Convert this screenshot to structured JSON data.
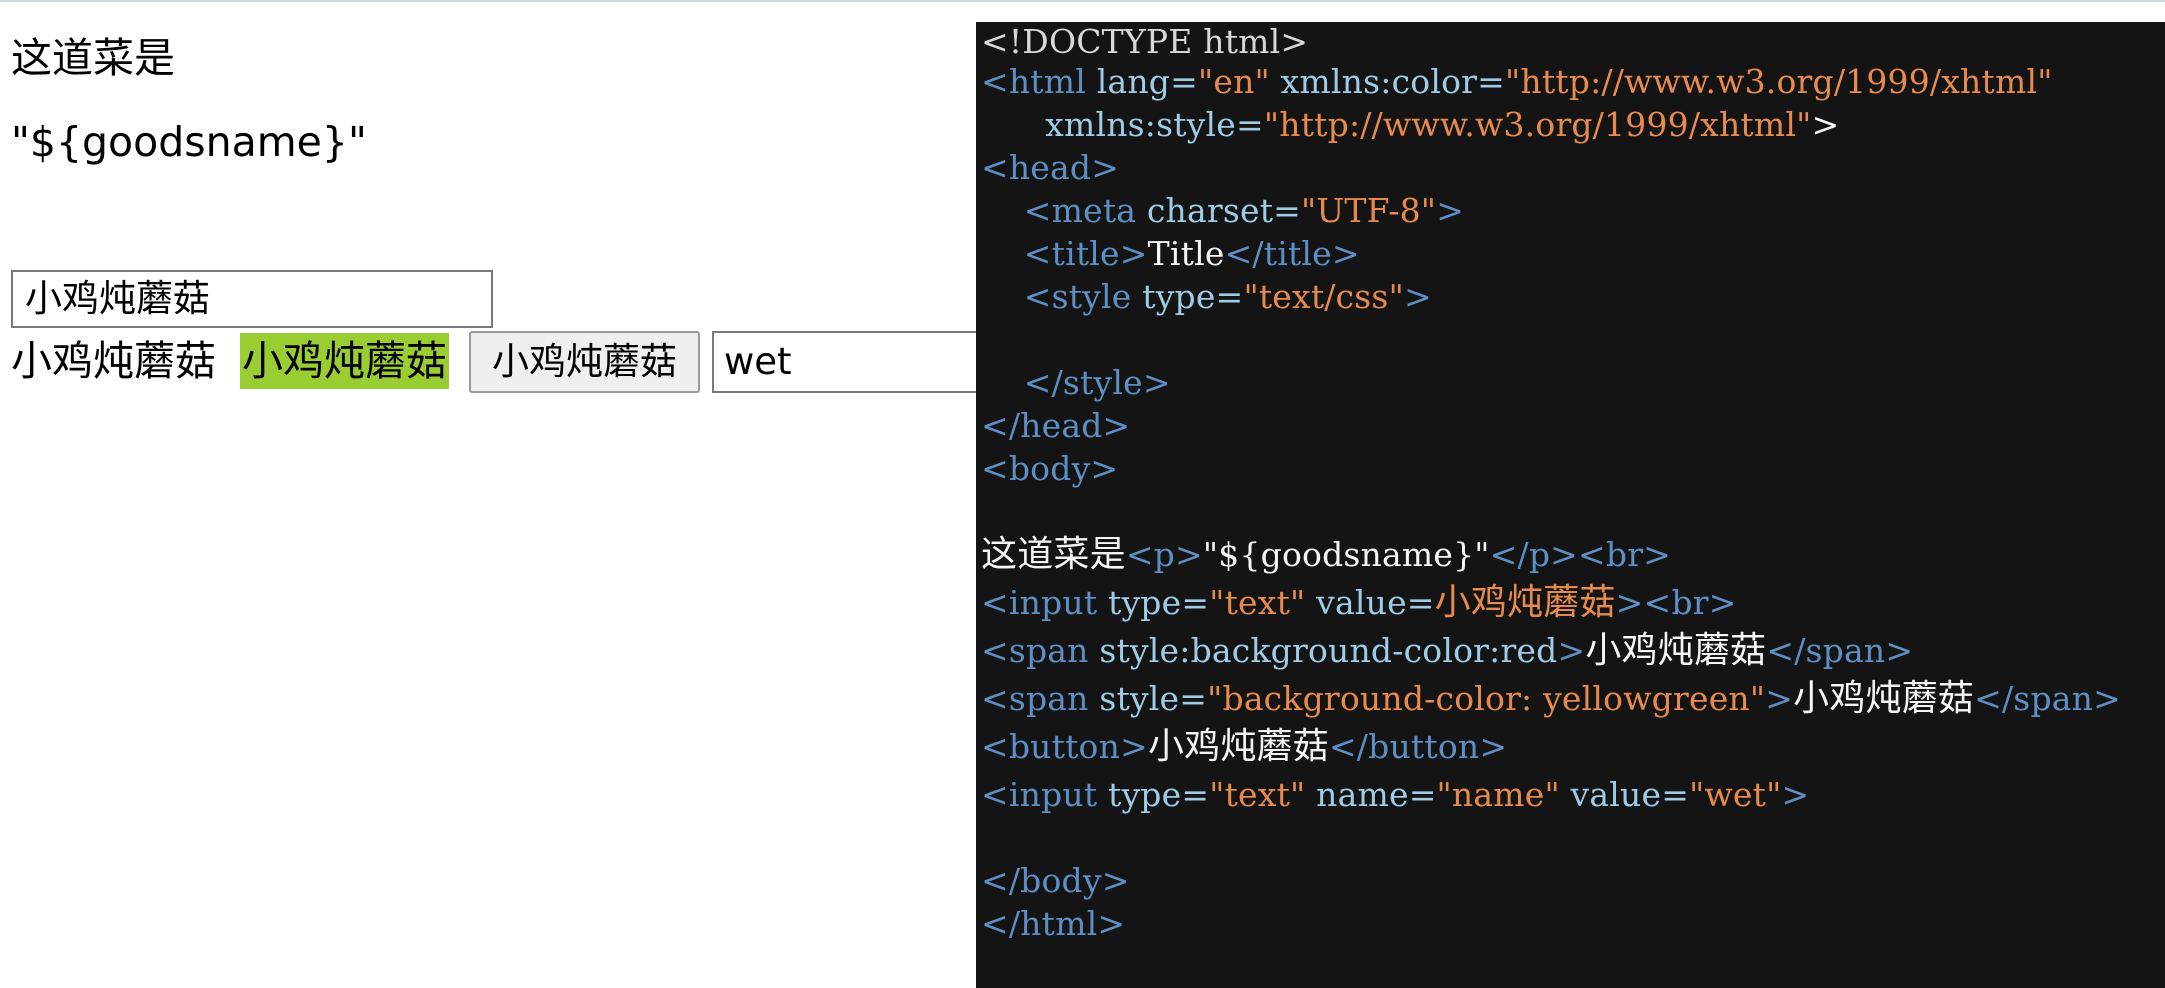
{
  "preview": {
    "heading": "这道菜是",
    "paragraph": "\"${goodsname}\"",
    "input1_value": "小鸡炖蘑菇",
    "span_plain": "小鸡炖蘑菇",
    "span_highlight": "小鸡炖蘑菇",
    "highlight_color": "#9acd32",
    "button_label": "小鸡炖蘑菇",
    "input2_value": "wet"
  },
  "editor": {
    "background": "#141414",
    "l1": {
      "dt": "<!DOCTYPE html>"
    },
    "l2": {
      "open": "<html",
      "a1": " lang=",
      "v1": "\"en\"",
      "a2": " xmlns:color=",
      "v2": "\"http://www.w3.org/1999/xhtml\""
    },
    "l3": {
      "indent": "      ",
      "a1": "xmlns:style=",
      "v1": "\"http://www.w3.org/1999/xhtml\"",
      "close": ">"
    },
    "l4": {
      "t": "<head>"
    },
    "l5": {
      "indent": "    ",
      "open": "<meta",
      "a1": " charset=",
      "v1": "\"UTF-8\"",
      "close": ">"
    },
    "l6": {
      "indent": "    ",
      "open": "<title>",
      "text": "Title",
      "close": "</title>"
    },
    "l7": {
      "indent": "    ",
      "open": "<style",
      "a1": " type=",
      "v1": "\"text/css\"",
      "close": ">"
    },
    "l9": {
      "indent": "    ",
      "t": "</style>"
    },
    "l10": {
      "t": "</head>"
    },
    "l11": {
      "t": "<body>"
    },
    "l13": {
      "text1": "这道菜是",
      "open": "<p>",
      "text2": "\"${goodsname}\"",
      "close": "</p><br>"
    },
    "l14": {
      "open": "<input",
      "a1": " type=",
      "v1": "\"text\"",
      "a2": " value=",
      "v2": "小鸡炖蘑菇",
      "close": "><br>"
    },
    "l15": {
      "open": "<span",
      "a1": " style:background-color:red",
      "close": ">",
      "text": "小鸡炖蘑菇",
      "end": "</span>"
    },
    "l16": {
      "open": "<span",
      "a1": " style=",
      "v1": "\"background-color: yellowgreen\"",
      "close": ">",
      "text": "小鸡炖蘑菇",
      "end": "</span>"
    },
    "l17": {
      "open": "<button>",
      "text": "小鸡炖蘑菇",
      "close": "</button>"
    },
    "l18": {
      "open": "<input",
      "a1": " type=",
      "v1": "\"text\"",
      "a2": " name=",
      "v2": "\"name\"",
      "a3": " value=",
      "v3": "\"wet\"",
      "close": ">"
    },
    "l20": {
      "t": "</body>"
    },
    "l21": {
      "t": "</html>"
    }
  }
}
